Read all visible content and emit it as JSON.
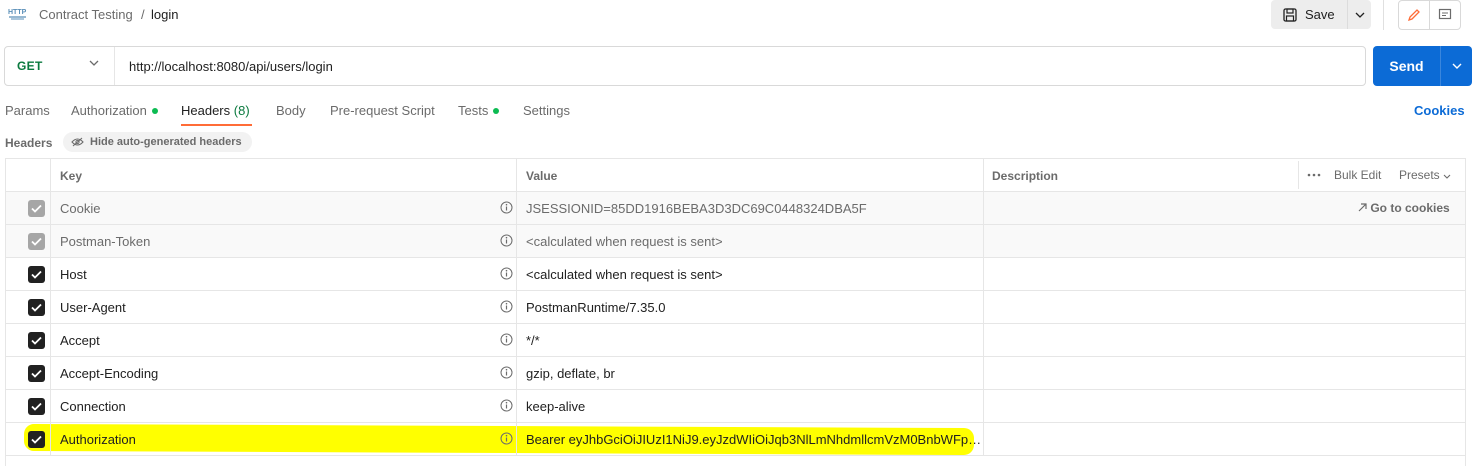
{
  "breadcrumb": {
    "icon": "http-request-icon",
    "parent": "Contract Testing",
    "separator": "/",
    "current": "login"
  },
  "toolbar": {
    "save_label": "Save"
  },
  "request": {
    "method": "GET",
    "url": "http://localhost:8080/api/users/login",
    "send_label": "Send"
  },
  "tabs": [
    {
      "label": "Params"
    },
    {
      "label": "Authorization",
      "dot": true
    },
    {
      "label": "Headers",
      "count": "(8)",
      "active": true
    },
    {
      "label": "Body"
    },
    {
      "label": "Pre-request Script"
    },
    {
      "label": "Tests",
      "dot": true
    },
    {
      "label": "Settings"
    }
  ],
  "cookies_label": "Cookies",
  "headers_section": {
    "title": "Headers",
    "hide_auto_label": "Hide auto-generated headers"
  },
  "table": {
    "columns": {
      "key": "Key",
      "value": "Value",
      "description": "Description"
    },
    "bulk_edit": "Bulk Edit",
    "presets": "Presets",
    "go_to_cookies": "Go to cookies",
    "rows": [
      {
        "key": "Cookie",
        "value": "JSESSIONID=85DD1916BEBA3D3DC69C0448324DBA5F",
        "checked": true,
        "auto": true
      },
      {
        "key": "Postman-Token",
        "value": "<calculated when request is sent>",
        "checked": true,
        "auto": true
      },
      {
        "key": "Host",
        "value": "<calculated when request is sent>",
        "checked": true,
        "auto": false
      },
      {
        "key": "User-Agent",
        "value": "PostmanRuntime/7.35.0",
        "checked": true,
        "auto": false
      },
      {
        "key": "Accept",
        "value": "*/*",
        "checked": true,
        "auto": false
      },
      {
        "key": "Accept-Encoding",
        "value": "gzip, deflate, br",
        "checked": true,
        "auto": false
      },
      {
        "key": "Connection",
        "value": "keep-alive",
        "checked": true,
        "auto": false
      },
      {
        "key": "Authorization",
        "value": "Bearer eyJhbGciOiJIUzI1NiJ9.eyJzdWIiOiJqb3NlLmNhdmllcmVzM0BnbWFpbC...",
        "checked": true,
        "auto": false,
        "highlighted": true
      }
    ]
  },
  "colors": {
    "accent": "#ff6c37",
    "primary": "#0c6bd6",
    "method_get": "#0b7a3f",
    "status_dot": "#0cbb52",
    "highlight": "#ffff00"
  }
}
